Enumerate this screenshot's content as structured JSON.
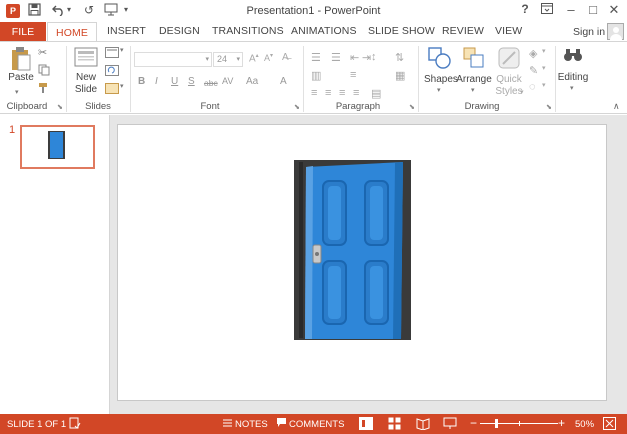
{
  "window": {
    "title": "Presentation1 - PowerPoint",
    "app_logo_letter": "P",
    "help": "?",
    "restore": "⊡",
    "minimize": "–",
    "maximize": "□",
    "close": "✕"
  },
  "qat": {
    "save": "🖫",
    "undo": "↶",
    "undo_more": "▾",
    "redo": "↺",
    "present": "⊡",
    "customize": "▾"
  },
  "tabs": [
    "FILE",
    "HOME",
    "INSERT",
    "DESIGN",
    "TRANSITIONS",
    "ANIMATIONS",
    "SLIDE SHOW",
    "REVIEW",
    "VIEW"
  ],
  "account": {
    "signin": "Sign in"
  },
  "ribbon": {
    "groups": {
      "clipboard": "Clipboard",
      "slides": "Slides",
      "font": "Font",
      "paragraph": "Paragraph",
      "drawing": "Drawing"
    },
    "paste": "Paste",
    "new_slide": "New Slide",
    "font_size": "24",
    "format_buttons": [
      "B",
      "I",
      "U",
      "S",
      "abc",
      "AV",
      "Aa",
      "A"
    ],
    "shapes": "Shapes",
    "arrange": "Arrange",
    "quick_styles_1": "Quick",
    "quick_styles_2": "Styles",
    "editing": "Editing"
  },
  "thumbnails": {
    "slide_number": "1"
  },
  "status": {
    "slide_info": "SLIDE 1 OF 1",
    "notes": "NOTES",
    "comments": "COMMENTS",
    "zoom_minus": "−",
    "zoom_plus": "+",
    "zoom_level": "50%"
  },
  "colors": {
    "accent": "#d24726",
    "door_blue": "#2e86d8",
    "frame": "#3a3a3a"
  },
  "icons": {
    "app": "powerpoint-logo-icon",
    "save": "save-icon",
    "undo": "undo-icon",
    "redo": "redo-icon",
    "present": "start-presentation-icon",
    "paste": "clipboard-icon",
    "cut": "scissors-icon",
    "copy": "copy-icon",
    "format_painter": "brush-icon",
    "new_slide": "new-slide-icon",
    "layout": "layout-icon",
    "reset": "reset-icon",
    "section": "section-icon",
    "shapes": "shapes-icon",
    "arrange": "arrange-icon",
    "quick_styles": "quick-styles-icon",
    "editing": "binoculars-icon",
    "notes": "notes-icon",
    "comments": "comment-icon",
    "normal_view": "normal-view-icon",
    "sorter_view": "slide-sorter-icon",
    "reading_view": "reading-view-icon",
    "slideshow_view": "slideshow-icon",
    "fit": "fit-to-window-icon"
  }
}
